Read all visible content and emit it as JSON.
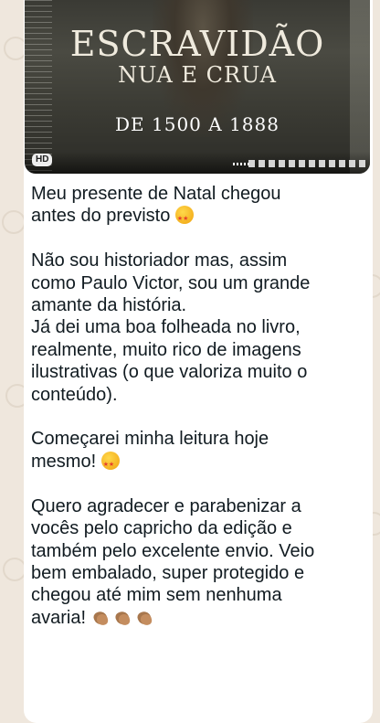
{
  "media": {
    "title_line1": "ESCRAVIDÃO",
    "title_line2": "NUA E CRUA",
    "title_line3": "DE 1500 A 1888",
    "badge": "HD"
  },
  "message": {
    "p1_line1": "Meu presente de Natal chegou",
    "p1_line2": "antes do previsto",
    "p2_line1": "Não sou historiador mas, assim",
    "p2_line2": "como Paulo Victor, sou um grande",
    "p2_line3": "amante da história.",
    "p2_line4": "Já dei uma boa folheada no livro,",
    "p2_line5": "realmente, muito rico de imagens",
    "p2_line6": "ilustrativas (o que valoriza muito o",
    "p2_line7": "conteúdo).",
    "p3_line1": "Começarei minha leitura hoje",
    "p3_line2": "mesmo!",
    "p4_line1": "Quero agradecer e parabenizar a",
    "p4_line2": "vocês pelo capricho da edição e",
    "p4_line3": "também pelo excelente envio. Veio",
    "p4_line4": "bem embalado, super protegido e",
    "p4_line5": "chegou até mim sem nenhuma",
    "p4_line6": "avaria!"
  },
  "icons": {
    "star_struck": "star-struck-emoji",
    "clap": "clapping-hands-emoji"
  },
  "colors": {
    "background": "#efe7dd",
    "bubble": "#ffffff",
    "text": "#111b21"
  }
}
